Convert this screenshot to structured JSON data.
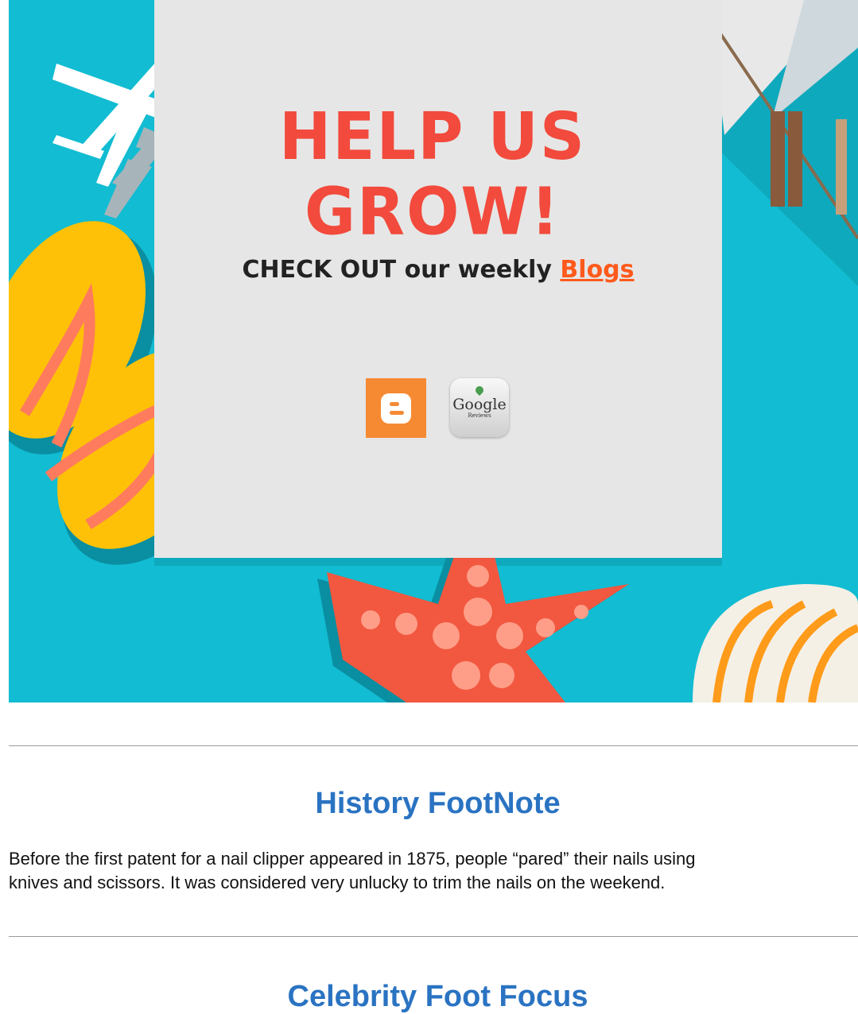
{
  "banner": {
    "headline": "HELP US GROW!",
    "blog_prefix": "CHECK OUT our weekly ",
    "blog_link": "Blogs",
    "icons": [
      "blogger-icon",
      "google-reviews-icon"
    ],
    "google_text": "Google",
    "google_sub": "Reviews"
  },
  "history": {
    "title": "History FootNote",
    "line1": "Before the first patent for a nail clipper appeared in 1875, people “pared” their nails using",
    "line2": "knives and scissors. It was considered very unlucky to trim the nails on the weekend."
  },
  "celebrity": {
    "title": "Celebrity Foot Focus"
  },
  "colors": {
    "banner_bg": "#12bcd2",
    "headline": "#f24a3c",
    "link": "#ff5a1c",
    "section_title": "#2a73c2"
  }
}
